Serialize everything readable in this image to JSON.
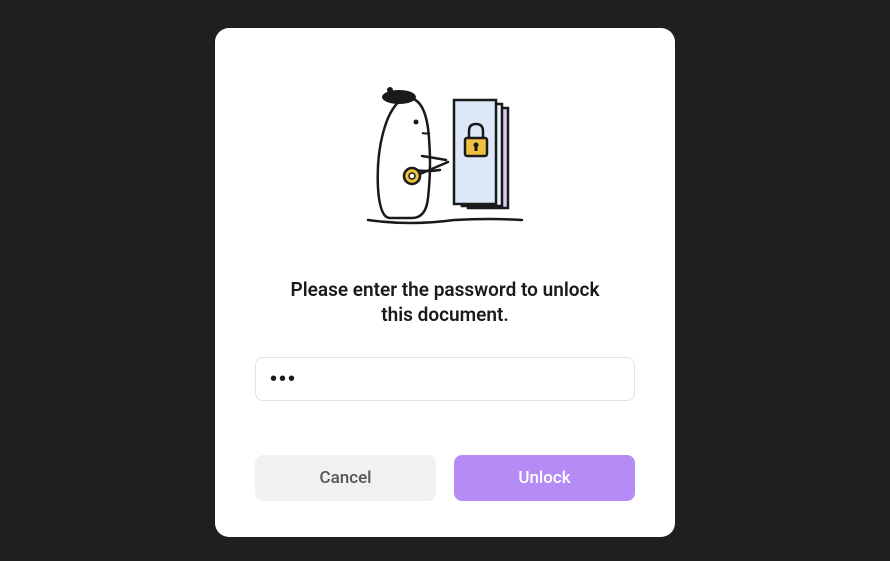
{
  "modal": {
    "prompt": "Please enter the password to unlock this document.",
    "password_value": "•••",
    "cancel_label": "Cancel",
    "unlock_label": "Unlock",
    "colors": {
      "primary": "#b58cf6",
      "cancel_bg": "#f1f1f1",
      "background": "#ffffff",
      "overlay": "#1f1f1f"
    },
    "illustration": {
      "name": "character-unlock-document-icon"
    }
  }
}
